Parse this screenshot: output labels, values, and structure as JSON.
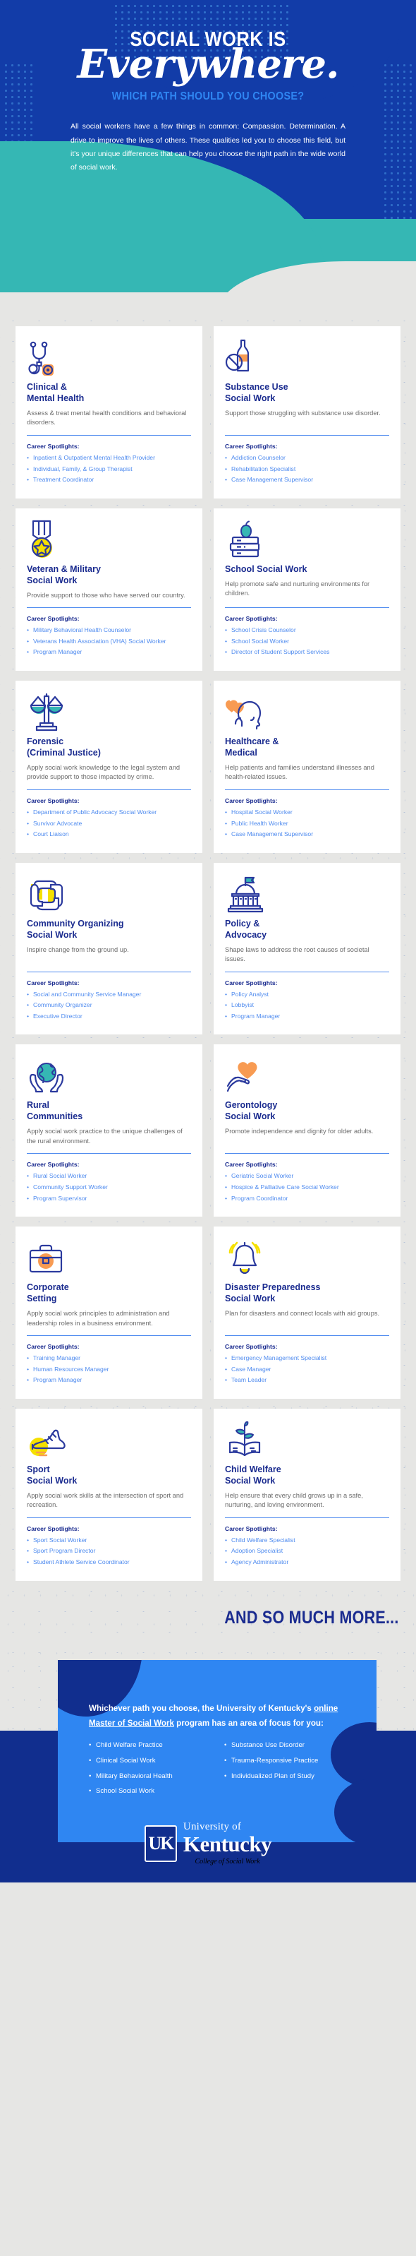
{
  "hero": {
    "line1": "SOCIAL WORK IS",
    "script": "Everywhere.",
    "subtitle": "WHICH PATH SHOULD YOU CHOOSE?",
    "paragraph": "All social workers have a few things in common: Compassion. Determination. A drive to improve the lives of others. These qualities led you to choose this field, but it's your unique differences that can help you choose the right path in the wide world of social work."
  },
  "spotlights_label": "Career Spotlights:",
  "cards": [
    {
      "icon": "stethoscope-icon",
      "title": "Clinical &\nMental Health",
      "desc": "Assess & treat mental health conditions and behavioral disorders.",
      "spotlights": [
        "Inpatient & Outpatient Mental Health Provider",
        "Individual, Family, & Group Therapist",
        "Treatment Coordinator"
      ]
    },
    {
      "icon": "no-alcohol-bottle-icon",
      "title": "Substance Use\nSocial Work",
      "desc": "Support those struggling with substance use disorder.",
      "spotlights": [
        "Addiction Counselor",
        "Rehabilitation Specialist",
        "Case Management Supervisor"
      ]
    },
    {
      "icon": "military-medal-icon",
      "title": "Veteran & Military\nSocial Work",
      "desc": "Provide support to those who have served our country.",
      "spotlights": [
        "Military Behavioral Health Counselor",
        "Veterans Health Association (VHA) Social Worker",
        "Program Manager"
      ]
    },
    {
      "icon": "books-apple-icon",
      "title": "School Social Work",
      "desc": "Help promote safe and nurturing environments for children.",
      "spotlights": [
        "School Crisis Counselor",
        "School Social Worker",
        "Director of Student Support Services"
      ]
    },
    {
      "icon": "scales-of-justice-icon",
      "title": "Forensic\n(Criminal Justice)",
      "desc": "Apply social work knowledge to the legal system and provide support to those impacted by crime.",
      "spotlights": [
        "Department of Public Advocacy Social Worker",
        "Survivor Advocate",
        "Court Liaison"
      ]
    },
    {
      "icon": "head-heart-icon",
      "title": "Healthcare &\nMedical",
      "desc": "Help patients and families understand illnesses and health-related issues.",
      "spotlights": [
        "Hospital Social Worker",
        "Public Health Worker",
        "Case Management Supervisor"
      ]
    },
    {
      "icon": "interlocking-hands-icon",
      "title": "Community Organizing\nSocial Work",
      "desc": "Inspire change from the ground up.",
      "spotlights": [
        "Social and Community Service Manager",
        "Community Organizer",
        "Executive Director"
      ]
    },
    {
      "icon": "capitol-building-icon",
      "title": "Policy &\nAdvocacy",
      "desc": "Shape laws to address the root causes of societal issues.",
      "spotlights": [
        "Policy Analyst",
        "Lobbyist",
        "Program Manager"
      ]
    },
    {
      "icon": "hands-holding-globe-icon",
      "title": "Rural\nCommunities",
      "desc": "Apply social work practice to the unique challenges of the rural environment.",
      "spotlights": [
        "Rural Social Worker",
        "Community Support Worker",
        "Program Supervisor"
      ]
    },
    {
      "icon": "hand-holding-heart-icon",
      "title": "Gerontology\nSocial Work",
      "desc": "Promote independence and dignity for older adults.",
      "spotlights": [
        "Geriatric Social Worker",
        "Hospice & Palliative Care Social Worker",
        "Program Coordinator"
      ]
    },
    {
      "icon": "briefcase-icon",
      "title": "Corporate\nSetting",
      "desc": "Apply social work principles to administration and leadership roles in a business environment.",
      "spotlights": [
        "Training Manager",
        "Human Resources Manager",
        "Program Manager"
      ]
    },
    {
      "icon": "alarm-bell-icon",
      "title": "Disaster Preparedness\nSocial Work",
      "desc": "Plan for disasters and connect locals with aid groups.",
      "spotlights": [
        "Emergency Management Specialist",
        "Case Manager",
        "Team Leader"
      ]
    },
    {
      "icon": "running-shoe-icon",
      "title": "Sport\nSocial Work",
      "desc": "Apply social work skills at the intersection of sport and recreation.",
      "spotlights": [
        "Sport Social Worker",
        "Sport Program Director",
        "Student Athlete Service Coordinator"
      ]
    },
    {
      "icon": "book-sprout-icon",
      "title": "Child Welfare\nSocial Work",
      "desc": "Help ensure that every child grows up in a safe, nurturing, and loving environment.",
      "spotlights": [
        "Child Welfare Specialist",
        "Adoption Specialist",
        "Agency Administrator"
      ]
    }
  ],
  "more": {
    "text": "AND SO MUCH MORE..."
  },
  "cta": {
    "head_before": "Whichever path you choose, the University of Kentucky's ",
    "head_link": "online Master of Social Work",
    "head_after": " program has an area of focus for you:",
    "column_left": [
      "Child Welfare Practice",
      "Clinical Social Work",
      "Military Behavioral Health",
      "School Social Work"
    ],
    "column_right": [
      "Substance Use Disorder",
      "Trauma-Responsive Practice",
      "Individualized Plan of Study"
    ]
  },
  "logo": {
    "mark": "UK",
    "line1": "University of",
    "line2": "Kentucky",
    "line3": "College of Social Work"
  },
  "colors": {
    "navy": "#112e8e",
    "royal": "#123ca8",
    "blue": "#2f86f2",
    "light_blue": "#4f8bef",
    "teal": "#35b7b4",
    "yellow": "#f5e000",
    "orange": "#f89b52",
    "grey_bg": "#e6e6e4"
  }
}
